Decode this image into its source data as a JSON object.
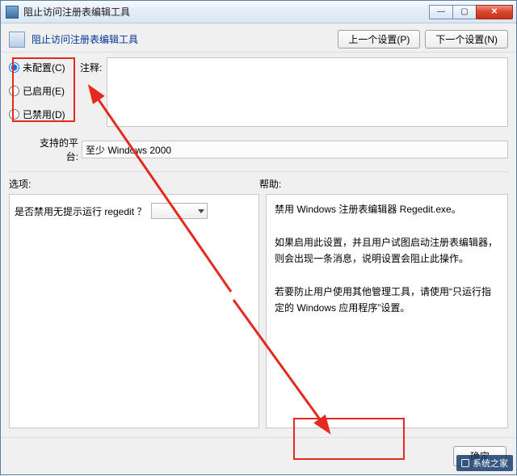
{
  "window": {
    "title": "阻止访问注册表编辑工具",
    "min_tip": "最小化",
    "max_tip": "最大化",
    "close_tip": "关闭"
  },
  "header": {
    "heading": "阻止访问注册表编辑工具",
    "prev_btn": "上一个设置(P)",
    "next_btn": "下一个设置(N)"
  },
  "radios": {
    "not_configured": "未配置(C)",
    "enabled": "已启用(E)",
    "disabled": "已禁用(D)",
    "selected": "not_configured"
  },
  "comment": {
    "label": "注释:",
    "value": ""
  },
  "platform": {
    "label": "支持的平台:",
    "value": "至少 Windows 2000"
  },
  "sections": {
    "options": "选项:",
    "help": "帮助:"
  },
  "options": {
    "question": "是否禁用无提示运行 regedit ？",
    "dropdown_value": ""
  },
  "help": {
    "p1": "禁用 Windows 注册表编辑器 Regedit.exe。",
    "p2": "如果启用此设置，并且用户试图启动注册表编辑器，则会出现一条消息，说明设置会阻止此操作。",
    "p3": "若要防止用户使用其他管理工具，请使用“只运行指定的 Windows 应用程序”设置。"
  },
  "buttons": {
    "ok": "确定"
  },
  "watermark": {
    "text": "系统之家"
  }
}
